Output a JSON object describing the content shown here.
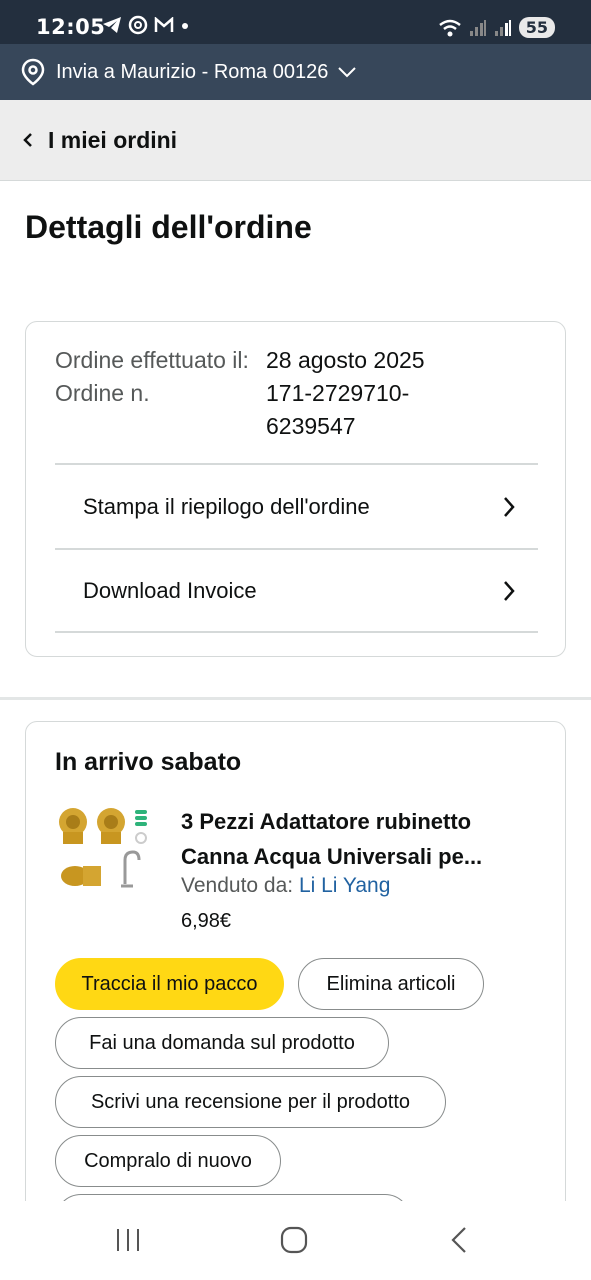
{
  "status": {
    "time": "12:05",
    "battery": "55"
  },
  "delivery": {
    "label": "Invia a Maurizio - Roma 00126"
  },
  "back": {
    "label": "I miei ordini"
  },
  "page": {
    "title": "Dettagli dell'ordine"
  },
  "order": {
    "placed_label": "Ordine effettuato il:",
    "number_label": "Ordine n.",
    "date": "28 agosto 2025",
    "number": "171-2729710-6239547"
  },
  "links": [
    {
      "label": "Stampa il riepilogo dell'ordine"
    },
    {
      "label": "Download Invoice"
    }
  ],
  "shipment": {
    "status": "In arrivo sabato",
    "product_title": "3 Pezzi Adattatore rubinetto Canna Acqua Universali pe...",
    "sold_by_label": "Venduto da:",
    "seller": "Li Li Yang",
    "price": "6,98€"
  },
  "actions": {
    "track": "Traccia il mio pacco",
    "delete": "Elimina articoli",
    "question": "Fai una domanda sul prodotto",
    "review": "Scrivi una recensione per il prodotto",
    "buy_again": "Compralo di nuovo"
  },
  "colors": {
    "header": "#232f3e",
    "subheader": "#37475a",
    "primary_button": "#ffd814",
    "link": "#2162a1"
  }
}
